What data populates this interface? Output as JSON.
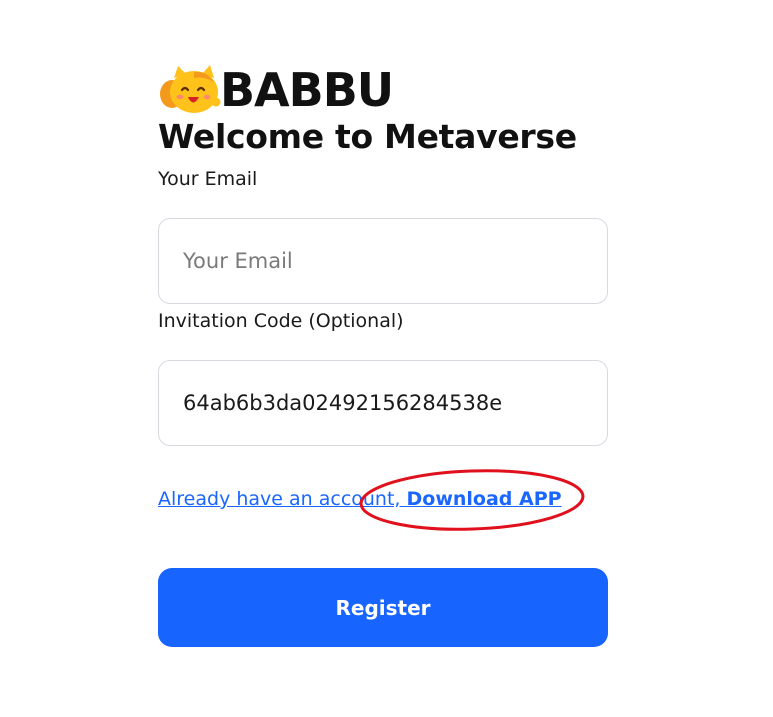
{
  "brand": {
    "name": "BABBU",
    "mascot_icon": "cat-mascot-icon"
  },
  "page": {
    "title": "Welcome to Metaverse"
  },
  "form": {
    "email": {
      "label": "Your Email",
      "placeholder": "Your Email",
      "value": ""
    },
    "invitation": {
      "label": "Invitation Code (Optional)",
      "value": "64ab6b3da02492156284538e"
    },
    "login_link": {
      "prefix": "Already have an account, ",
      "action": "Download APP"
    },
    "register_label": "Register"
  },
  "colors": {
    "accent": "#1764ff",
    "link": "#1a66ff",
    "annotation": "#e0101c"
  }
}
